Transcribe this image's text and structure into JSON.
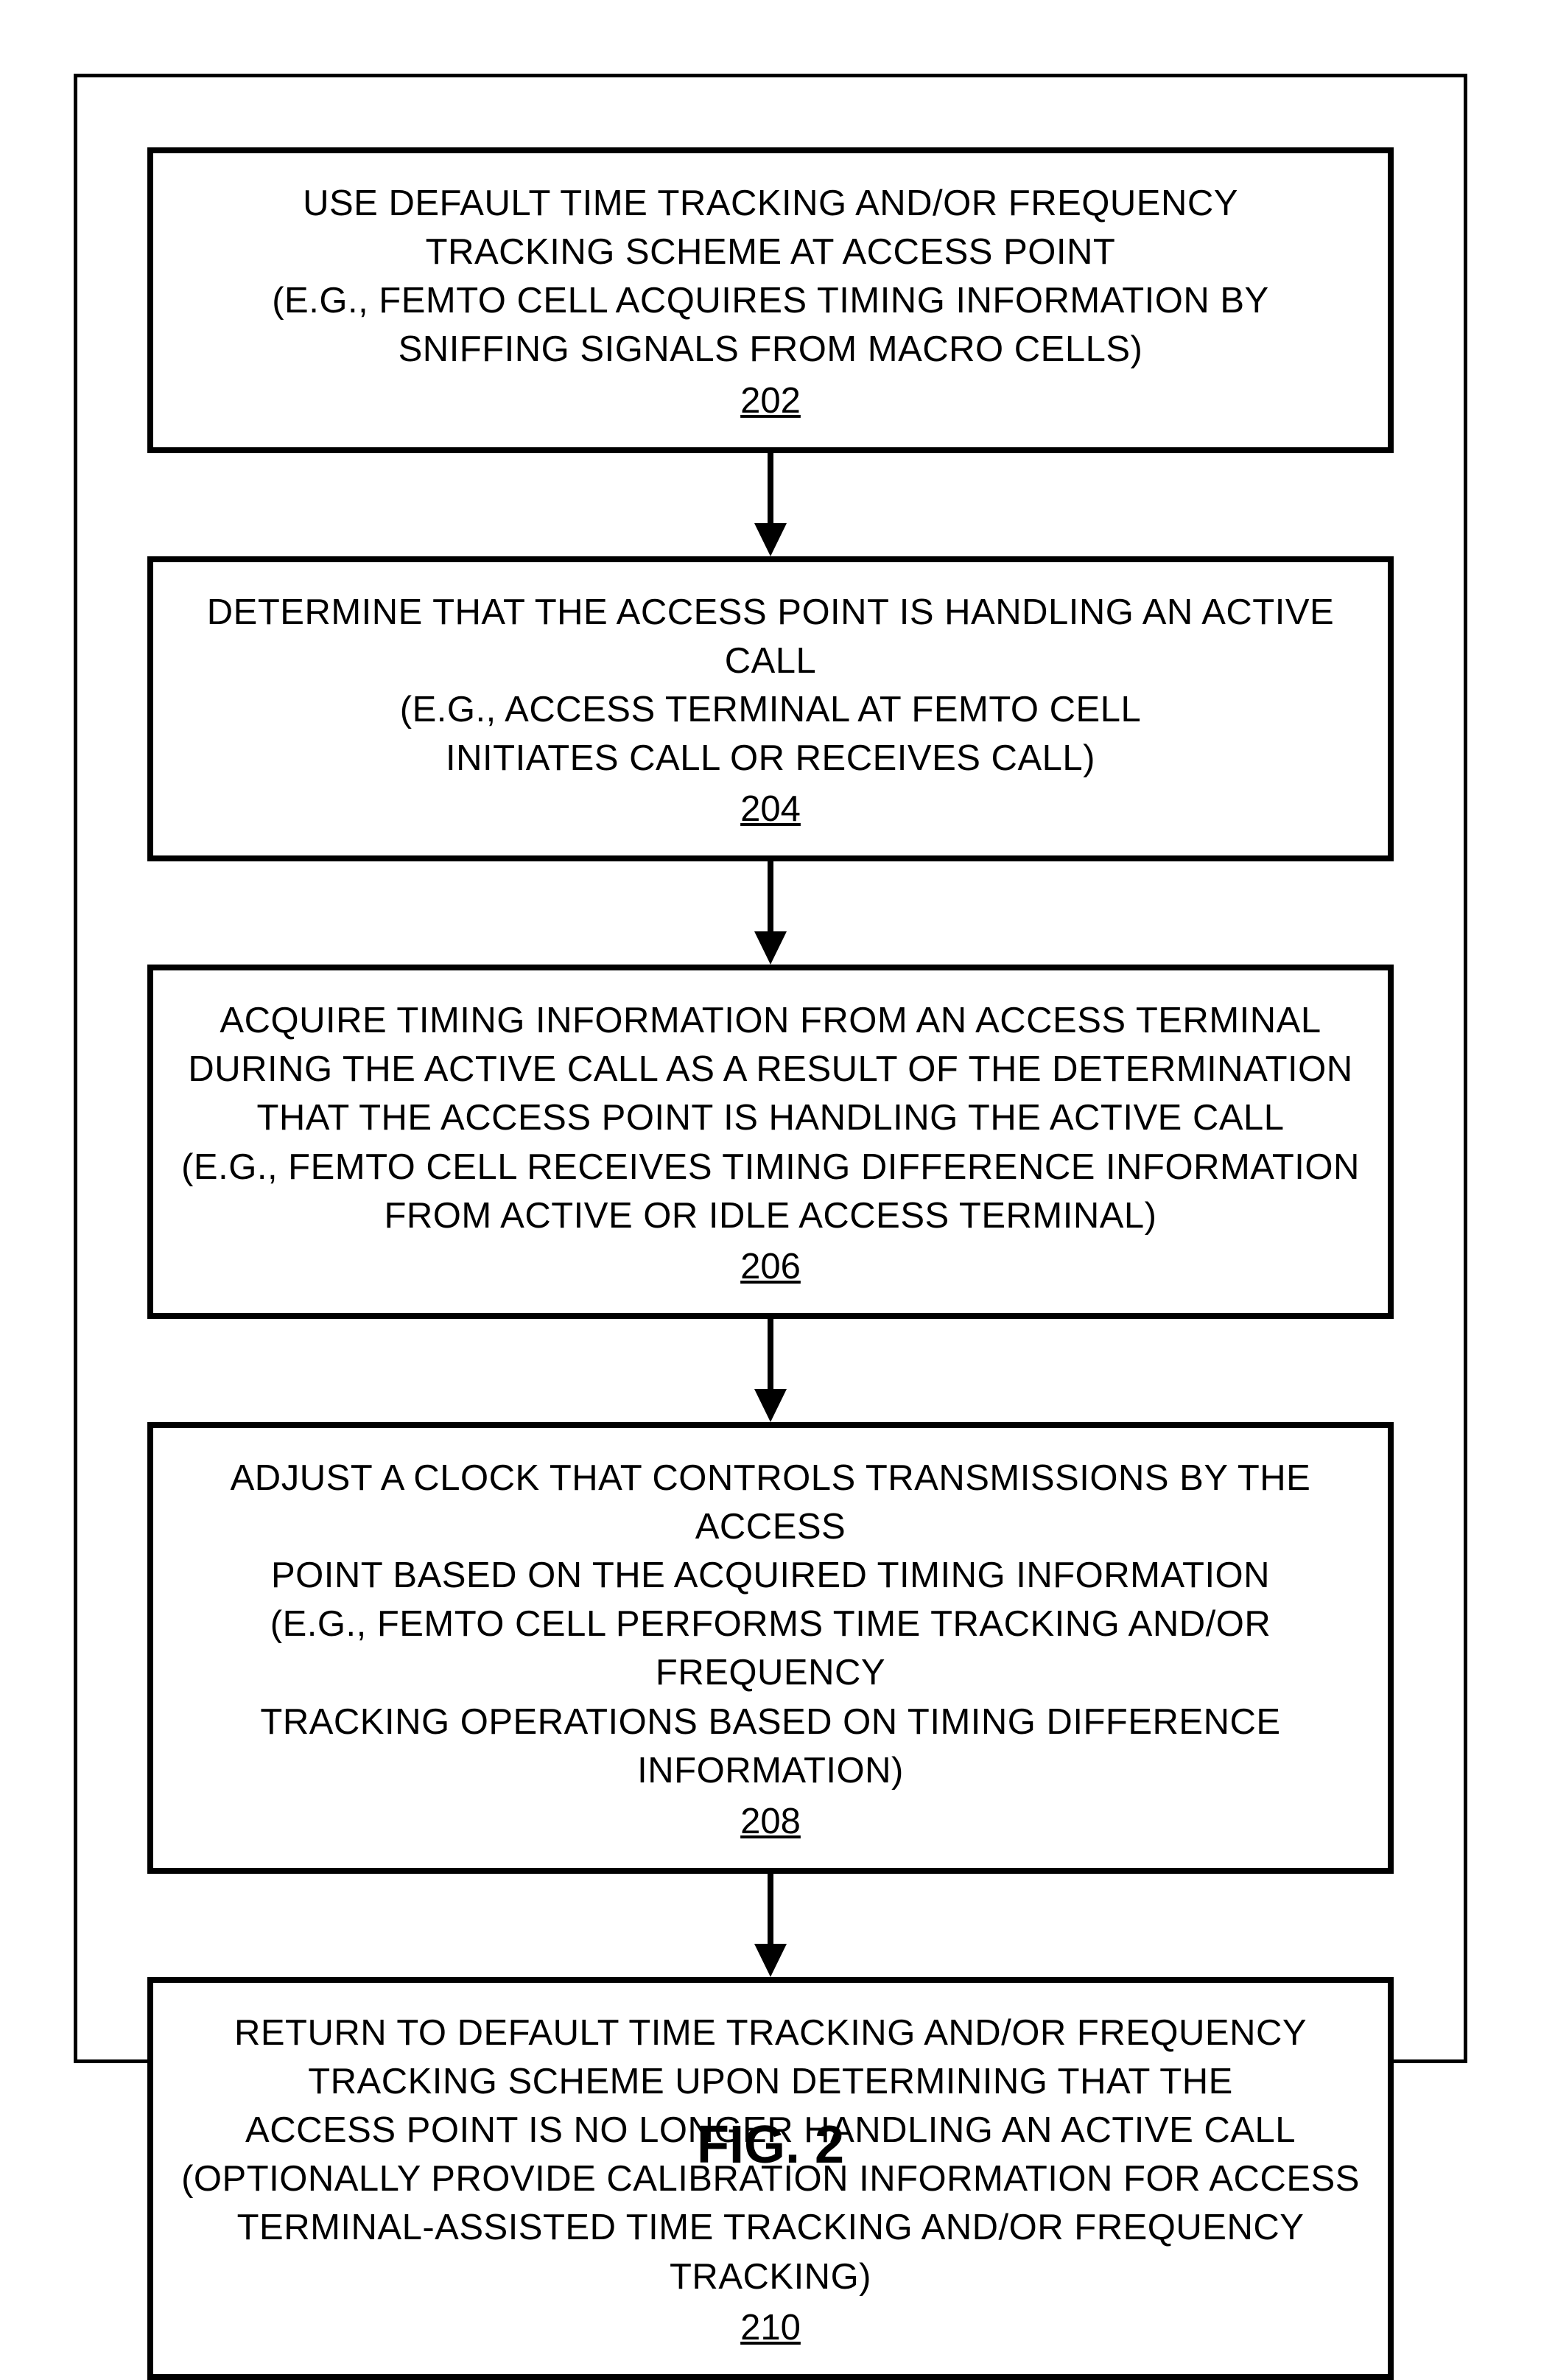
{
  "flowchart": {
    "boxes": [
      {
        "lines": [
          "USE DEFAULT TIME TRACKING AND/OR FREQUENCY",
          "TRACKING SCHEME AT ACCESS POINT",
          "(E.G., FEMTO CELL ACQUIRES TIMING INFORMATION BY",
          "SNIFFING SIGNALS FROM MACRO CELLS)"
        ],
        "number": "202"
      },
      {
        "lines": [
          "DETERMINE THAT THE ACCESS POINT IS HANDLING AN ACTIVE CALL",
          "(E.G., ACCESS TERMINAL AT FEMTO CELL",
          "INITIATES CALL OR RECEIVES CALL)"
        ],
        "number": "204"
      },
      {
        "lines": [
          "ACQUIRE TIMING INFORMATION FROM AN ACCESS TERMINAL",
          "DURING THE ACTIVE CALL AS A RESULT OF THE DETERMINATION",
          "THAT THE ACCESS POINT IS HANDLING THE ACTIVE CALL",
          "(E.G., FEMTO CELL RECEIVES TIMING DIFFERENCE INFORMATION",
          "FROM ACTIVE OR IDLE ACCESS TERMINAL)"
        ],
        "number": "206"
      },
      {
        "lines": [
          "ADJUST A CLOCK THAT CONTROLS TRANSMISSIONS BY THE ACCESS",
          "POINT BASED ON THE ACQUIRED TIMING INFORMATION",
          "(E.G., FEMTO CELL PERFORMS TIME TRACKING AND/OR FREQUENCY",
          "TRACKING OPERATIONS BASED ON TIMING DIFFERENCE INFORMATION)"
        ],
        "number": "208"
      },
      {
        "lines": [
          "RETURN TO DEFAULT TIME TRACKING AND/OR FREQUENCY",
          "TRACKING SCHEME UPON DETERMINING THAT THE",
          "ACCESS POINT IS NO LONGER HANDLING AN ACTIVE CALL",
          "(OPTIONALLY PROVIDE CALIBRATION INFORMATION FOR ACCESS",
          "TERMINAL-ASSISTED TIME TRACKING AND/OR FREQUENCY TRACKING)"
        ],
        "number": "210"
      }
    ]
  },
  "figure_label": "FIG. 2"
}
